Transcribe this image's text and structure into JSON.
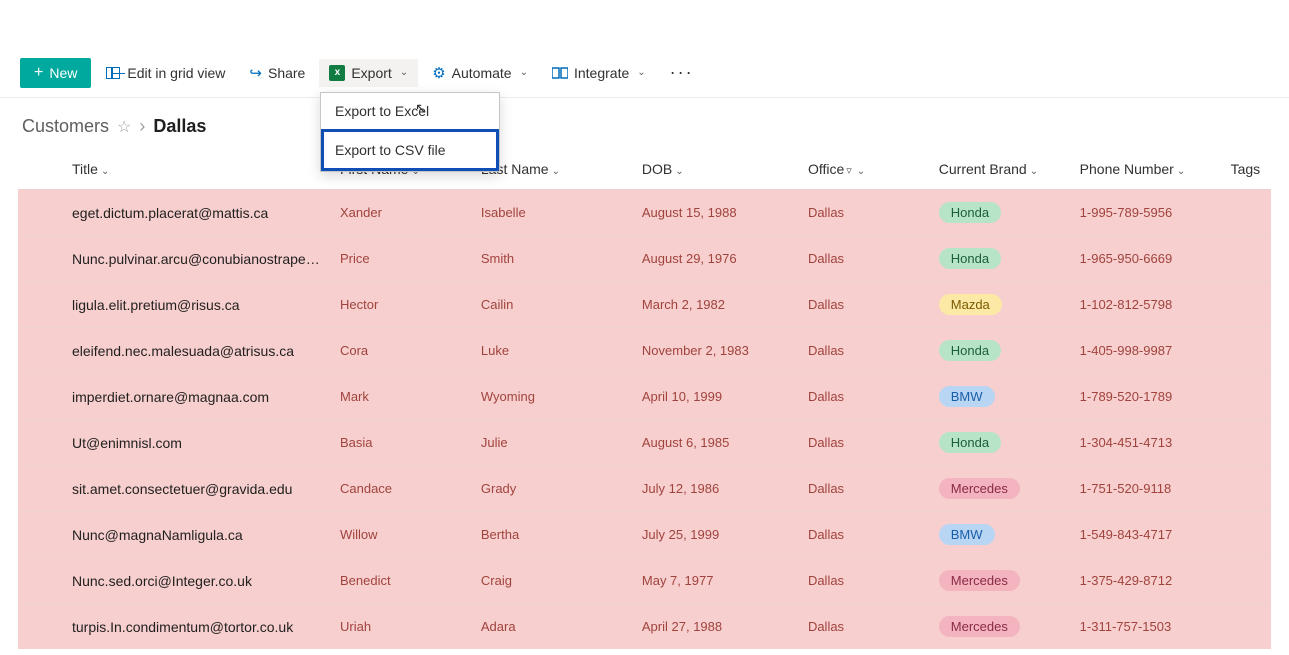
{
  "toolbar": {
    "new_label": "New",
    "edit_label": "Edit in grid view",
    "share_label": "Share",
    "export_label": "Export",
    "automate_label": "Automate",
    "integrate_label": "Integrate",
    "more_label": "···"
  },
  "export_menu": {
    "excel": "Export to Excel",
    "csv": "Export to CSV file"
  },
  "breadcrumb": {
    "list": "Customers",
    "view": "Dallas"
  },
  "columns": {
    "title": "Title",
    "first_name": "First Name",
    "last_name": "Last Name",
    "dob": "DOB",
    "office": "Office",
    "current_brand": "Current Brand",
    "phone": "Phone Number",
    "tags": "Tags"
  },
  "brand_colors": {
    "Honda": "honda",
    "Mazda": "mazda",
    "BMW": "bmw",
    "Mercedes": "mercedes"
  },
  "rows": [
    {
      "title": "eget.dictum.placerat@mattis.ca",
      "first": "Xander",
      "last": "Isabelle",
      "dob": "August 15, 1988",
      "office": "Dallas",
      "brand": "Honda",
      "phone": "1-995-789-5956"
    },
    {
      "title": "Nunc.pulvinar.arcu@conubianostraper.edu",
      "first": "Price",
      "last": "Smith",
      "dob": "August 29, 1976",
      "office": "Dallas",
      "brand": "Honda",
      "phone": "1-965-950-6669"
    },
    {
      "title": "ligula.elit.pretium@risus.ca",
      "first": "Hector",
      "last": "Cailin",
      "dob": "March 2, 1982",
      "office": "Dallas",
      "brand": "Mazda",
      "phone": "1-102-812-5798"
    },
    {
      "title": "eleifend.nec.malesuada@atrisus.ca",
      "first": "Cora",
      "last": "Luke",
      "dob": "November 2, 1983",
      "office": "Dallas",
      "brand": "Honda",
      "phone": "1-405-998-9987"
    },
    {
      "title": "imperdiet.ornare@magnaa.com",
      "first": "Mark",
      "last": "Wyoming",
      "dob": "April 10, 1999",
      "office": "Dallas",
      "brand": "BMW",
      "phone": "1-789-520-1789"
    },
    {
      "title": "Ut@enimnisl.com",
      "first": "Basia",
      "last": "Julie",
      "dob": "August 6, 1985",
      "office": "Dallas",
      "brand": "Honda",
      "phone": "1-304-451-4713"
    },
    {
      "title": "sit.amet.consectetuer@gravida.edu",
      "first": "Candace",
      "last": "Grady",
      "dob": "July 12, 1986",
      "office": "Dallas",
      "brand": "Mercedes",
      "phone": "1-751-520-9118"
    },
    {
      "title": "Nunc@magnaNamligula.ca",
      "first": "Willow",
      "last": "Bertha",
      "dob": "July 25, 1999",
      "office": "Dallas",
      "brand": "BMW",
      "phone": "1-549-843-4717"
    },
    {
      "title": "Nunc.sed.orci@Integer.co.uk",
      "first": "Benedict",
      "last": "Craig",
      "dob": "May 7, 1977",
      "office": "Dallas",
      "brand": "Mercedes",
      "phone": "1-375-429-8712"
    },
    {
      "title": "turpis.In.condimentum@tortor.co.uk",
      "first": "Uriah",
      "last": "Adara",
      "dob": "April 27, 1988",
      "office": "Dallas",
      "brand": "Mercedes",
      "phone": "1-311-757-1503"
    }
  ]
}
